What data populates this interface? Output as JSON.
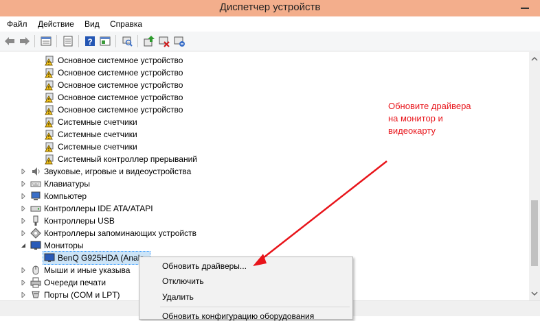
{
  "window": {
    "title": "Диспетчер устройств"
  },
  "menu": [
    "Файл",
    "Действие",
    "Вид",
    "Справка"
  ],
  "tree": {
    "system_devices": [
      "Основное системное устройство",
      "Основное системное устройство",
      "Основное системное устройство",
      "Основное системное устройство",
      "Основное системное устройство",
      "Системные счетчики",
      "Системные счетчики",
      "Системные счетчики",
      "Системный контроллер прерываний"
    ],
    "categories": [
      "Звуковые, игровые и видеоустройства",
      "Клавиатуры",
      "Компьютер",
      "Контроллеры IDE ATA/ATAPI",
      "Контроллеры USB",
      "Контроллеры запоминающих устройств",
      "Мониторы"
    ],
    "monitor_child": "BenQ G925HDA (Analo",
    "categories_after": [
      "Мыши и иные указыва",
      "Очереди печати",
      "Порты (COM и LPT)"
    ]
  },
  "context_menu": {
    "items": [
      "Обновить драйверы...",
      "Отключить",
      "Удалить",
      "Обновить конфигурацию оборудования"
    ]
  },
  "annotation": {
    "lines": [
      "Обновите драйвера",
      "на монитор и",
      "видеокарту"
    ],
    "color": "#e8141a"
  },
  "colors": {
    "titlebar": "#f3ae8c",
    "selection": "#cce4f7",
    "warning": "#f5c518"
  }
}
